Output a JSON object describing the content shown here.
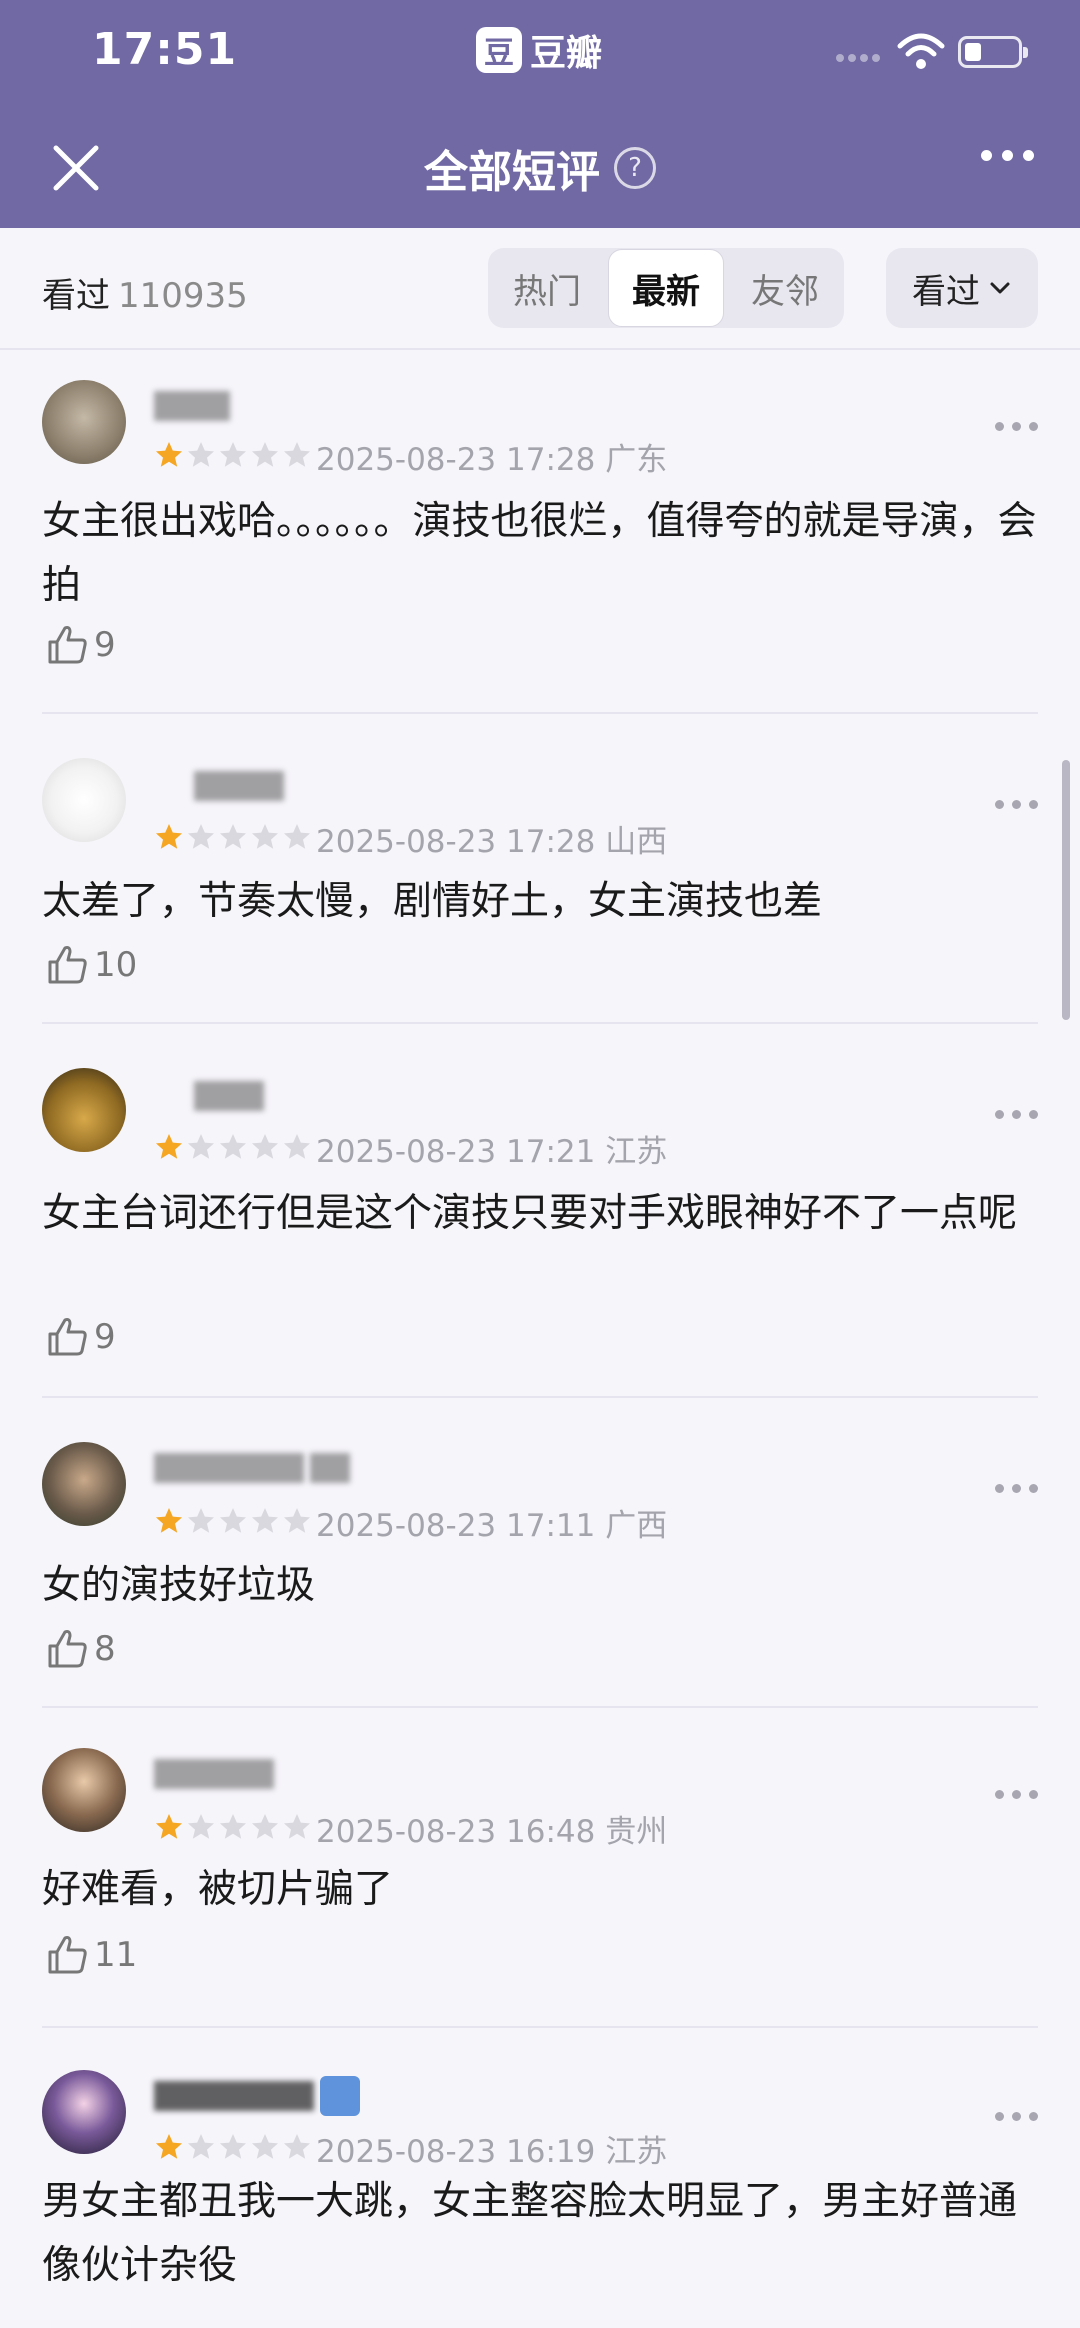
{
  "status": {
    "time": "17:51",
    "app_logo_char": "豆",
    "app_name": "豆瓣"
  },
  "nav": {
    "title": "全部短评",
    "help_glyph": "?"
  },
  "filter": {
    "seen_label": "看过",
    "seen_count": "110935",
    "tabs": [
      "热门",
      "最新",
      "友邻"
    ],
    "active_tab": "最新",
    "dropdown_label": "看过"
  },
  "colors": {
    "header_bg": "#7069a3",
    "star_filled": "#f5a623",
    "star_empty": "#d8d8de"
  },
  "reviews": [
    {
      "rating": 1,
      "time": "2025-08-23 17:28",
      "location": "广东",
      "text": "女主很出戏哈。。。。。。演技也很烂，值得夸的就是导演，会拍",
      "likes": "9",
      "lines": 2
    },
    {
      "rating": 1,
      "time": "2025-08-23 17:28",
      "location": "山西",
      "text": "太差了，节奏太慢，剧情好土，女主演技也差",
      "likes": "10",
      "lines": 1
    },
    {
      "rating": 1,
      "time": "2025-08-23 17:21",
      "location": "江苏",
      "text": "女主台词还行但是这个演技只要对手戏眼神好不了一点呢",
      "likes": "9",
      "lines": 2
    },
    {
      "rating": 1,
      "time": "2025-08-23 17:11",
      "location": "广西",
      "text": "女的演技好垃圾",
      "likes": "8",
      "lines": 1
    },
    {
      "rating": 1,
      "time": "2025-08-23 16:48",
      "location": "贵州",
      "text": "好难看，被切片骗了",
      "likes": "11",
      "lines": 1
    },
    {
      "rating": 1,
      "time": "2025-08-23 16:19",
      "location": "江苏",
      "text": "男女主都丑我一大跳，女主整容脸太明显了，男主好普通像伙计杂役",
      "likes": "",
      "lines": 2
    }
  ]
}
